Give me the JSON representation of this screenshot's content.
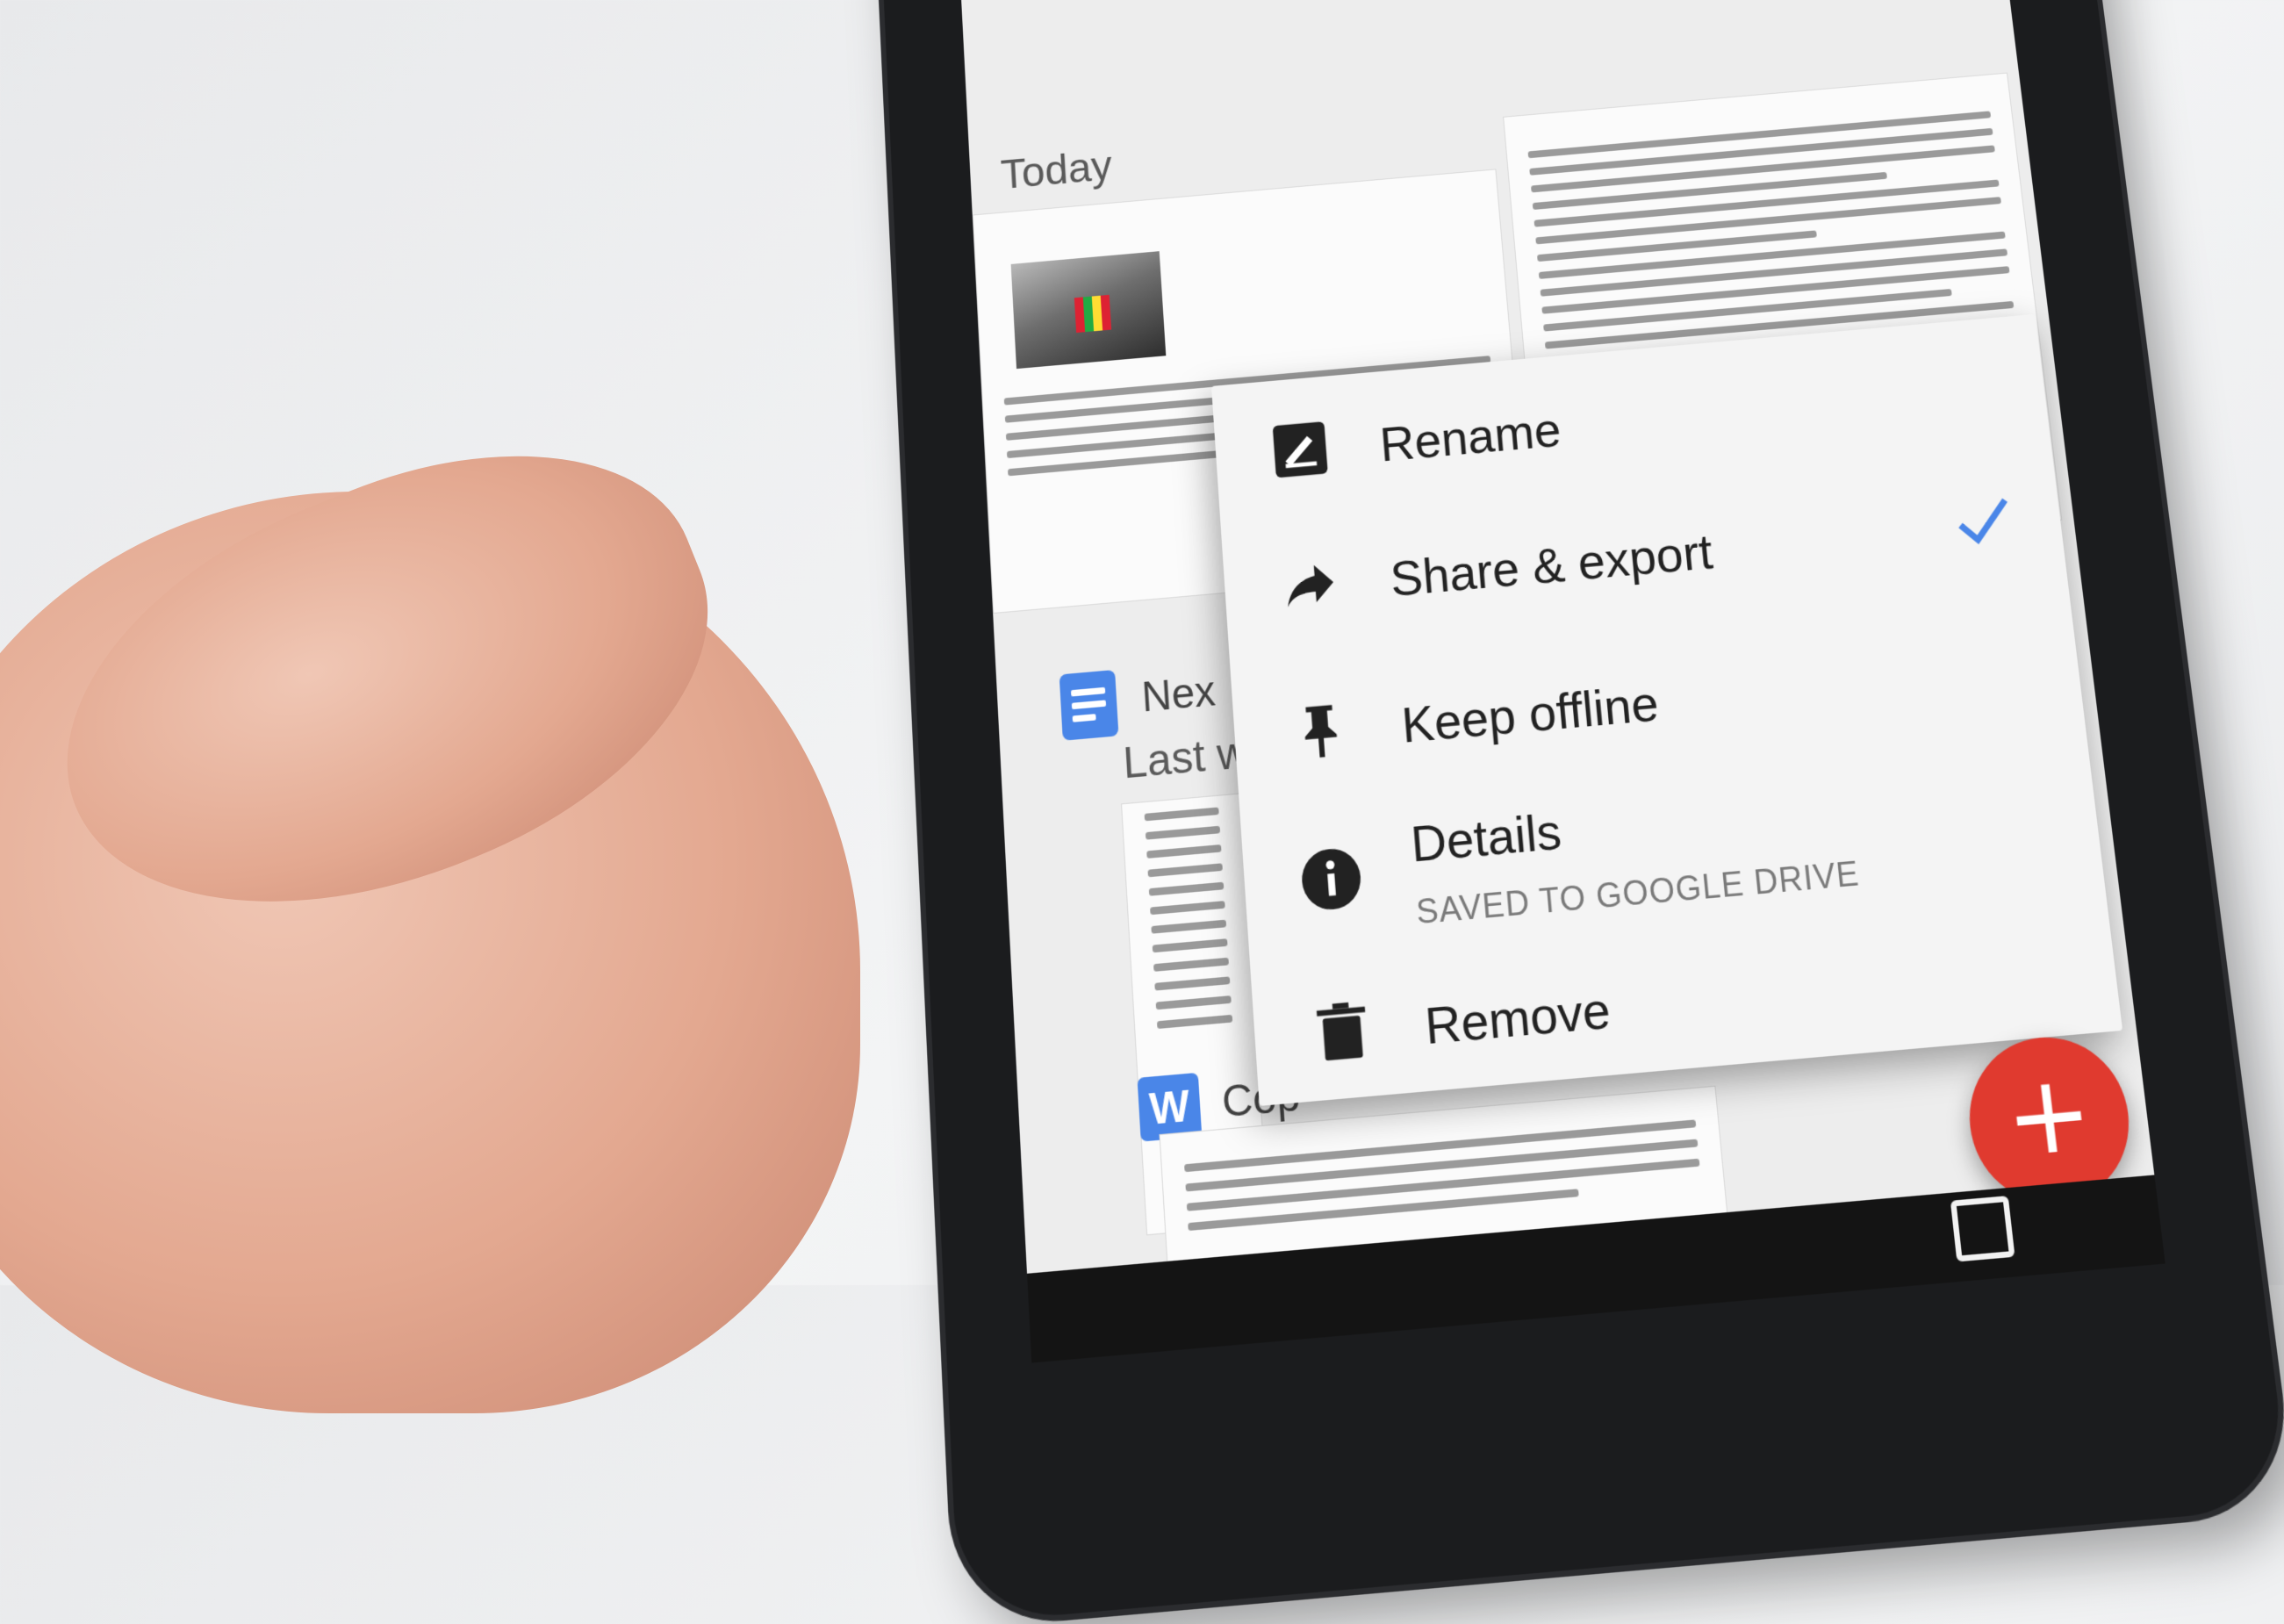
{
  "screen": {
    "sections": {
      "today": "Today",
      "last_week": "Last w"
    },
    "files": {
      "docs_file_partial": "Nex",
      "word_file_partial": "Cop",
      "word_icon_letter": "W"
    }
  },
  "context_menu": {
    "items": [
      {
        "label": "Rename",
        "icon": "rename-icon"
      },
      {
        "label": "Share & export",
        "icon": "share-icon",
        "checked": true
      },
      {
        "label": "Keep offline",
        "icon": "pin-icon"
      },
      {
        "label": "Details",
        "sublabel": "SAVED TO GOOGLE DRIVE",
        "icon": "info-icon"
      },
      {
        "label": "Remove",
        "icon": "trash-icon"
      }
    ]
  },
  "fab": {
    "label": "+",
    "color": "#e03a2f"
  },
  "colors": {
    "docs_blue": "#4a86e8",
    "check_blue": "#4a86e8"
  }
}
